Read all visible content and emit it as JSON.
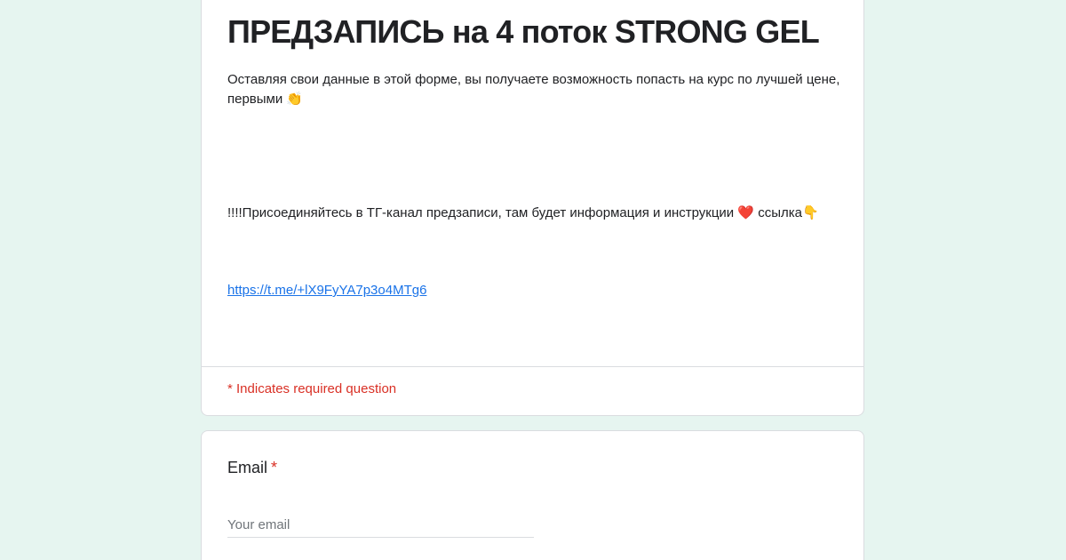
{
  "form": {
    "title": "ПРЕДЗАПИСЬ на 4 поток STRONG GEL",
    "description_1": "Оставляя свои данные в этой форме, вы получаете возможность попасть на курс по лучшей цене, первыми 👏",
    "description_2": "!!!!Присоединяйтесь в ТГ-канал предзаписи, там будет информация и инструкции ❤️ ссылка👇",
    "link_text": "https://t.me/+lX9FyYA7p3o4MTg6",
    "required_note": "* Indicates required question"
  },
  "question": {
    "label": "Email",
    "required_marker": "*",
    "placeholder": "Your email",
    "value": ""
  }
}
